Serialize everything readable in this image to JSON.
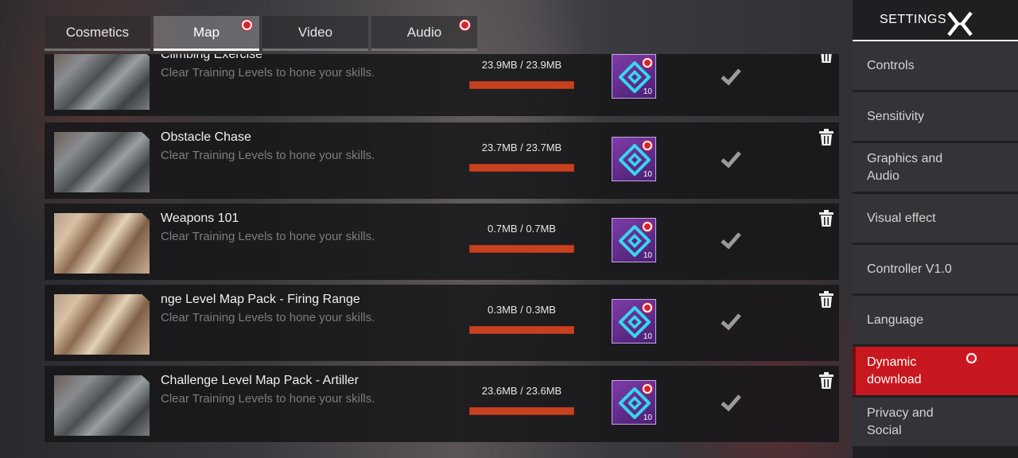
{
  "tabs": [
    {
      "label": "Cosmetics",
      "active": false,
      "notification": false
    },
    {
      "label": "Map",
      "active": true,
      "notification": true
    },
    {
      "label": "Video",
      "active": false,
      "notification": false
    },
    {
      "label": "Audio",
      "active": false,
      "notification": true
    }
  ],
  "items": [
    {
      "title": "Climbing Exercise",
      "desc": "Clear Training Levels to hone your skills.",
      "size": "23.9MB / 23.9MB",
      "progress": 1.0,
      "badge_num": "10",
      "thumb": "gray"
    },
    {
      "title": "Obstacle Chase",
      "desc": "Clear Training Levels to hone your skills.",
      "size": "23.7MB / 23.7MB",
      "progress": 1.0,
      "badge_num": "10",
      "thumb": "gray"
    },
    {
      "title": "Weapons 101",
      "desc": "Clear Training Levels to hone your skills.",
      "size": "0.7MB / 0.7MB",
      "progress": 1.0,
      "badge_num": "10",
      "thumb": "desert"
    },
    {
      "title": "nge Level Map Pack - Firing Range",
      "desc": "Clear Training Levels to hone your skills.",
      "size": "0.3MB / 0.3MB",
      "progress": 1.0,
      "badge_num": "10",
      "thumb": "desert"
    },
    {
      "title": "Challenge Level Map Pack - Artiller",
      "desc": "Clear Training Levels to hone your skills.",
      "size": "23.6MB / 23.6MB",
      "progress": 1.0,
      "badge_num": "10",
      "thumb": "gray"
    }
  ],
  "settings": {
    "title": "SETTINGS",
    "menu": [
      {
        "label": "Controls",
        "active": false,
        "notification": false
      },
      {
        "label": "Sensitivity",
        "active": false,
        "notification": false
      },
      {
        "label": "Graphics and Audio",
        "active": false,
        "notification": false
      },
      {
        "label": "Visual effect",
        "active": false,
        "notification": false
      },
      {
        "label": "Controller V1.0",
        "active": false,
        "notification": false
      },
      {
        "label": "Language",
        "active": false,
        "notification": false
      },
      {
        "label": "Dynamic download",
        "active": true,
        "notification": true
      },
      {
        "label": "Privacy and Social",
        "active": false,
        "notification": false
      }
    ]
  },
  "colors": {
    "accent_red": "#c8171e",
    "progress_orange": "#c8411f",
    "badge_purple": "#7d3ca8",
    "badge_cyan": "#37d6f0",
    "notification_red": "#d8232f"
  },
  "icons": {
    "close": "close-x-icon",
    "trash": "trash-icon",
    "check": "checkmark-icon",
    "badge": "diamond-badge-icon"
  }
}
